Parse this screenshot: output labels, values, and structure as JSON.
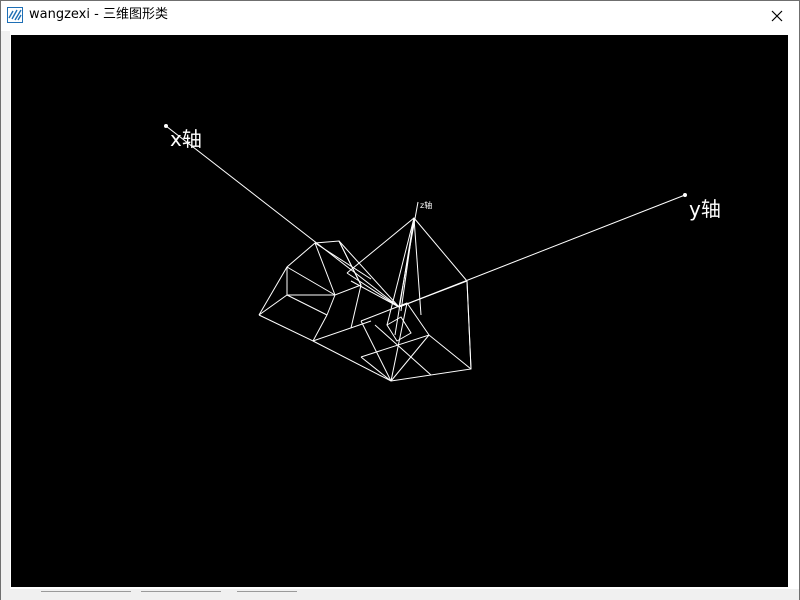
{
  "window": {
    "title": "wangzexi - 三维图形类",
    "app_icon": "app-window-icon",
    "close_icon": "close-icon"
  },
  "canvas": {
    "background": "#000000",
    "line_color": "#ffffff",
    "labels": {
      "x_axis": "x轴",
      "y_axis": "y轴",
      "z_axis": "z轴"
    }
  }
}
